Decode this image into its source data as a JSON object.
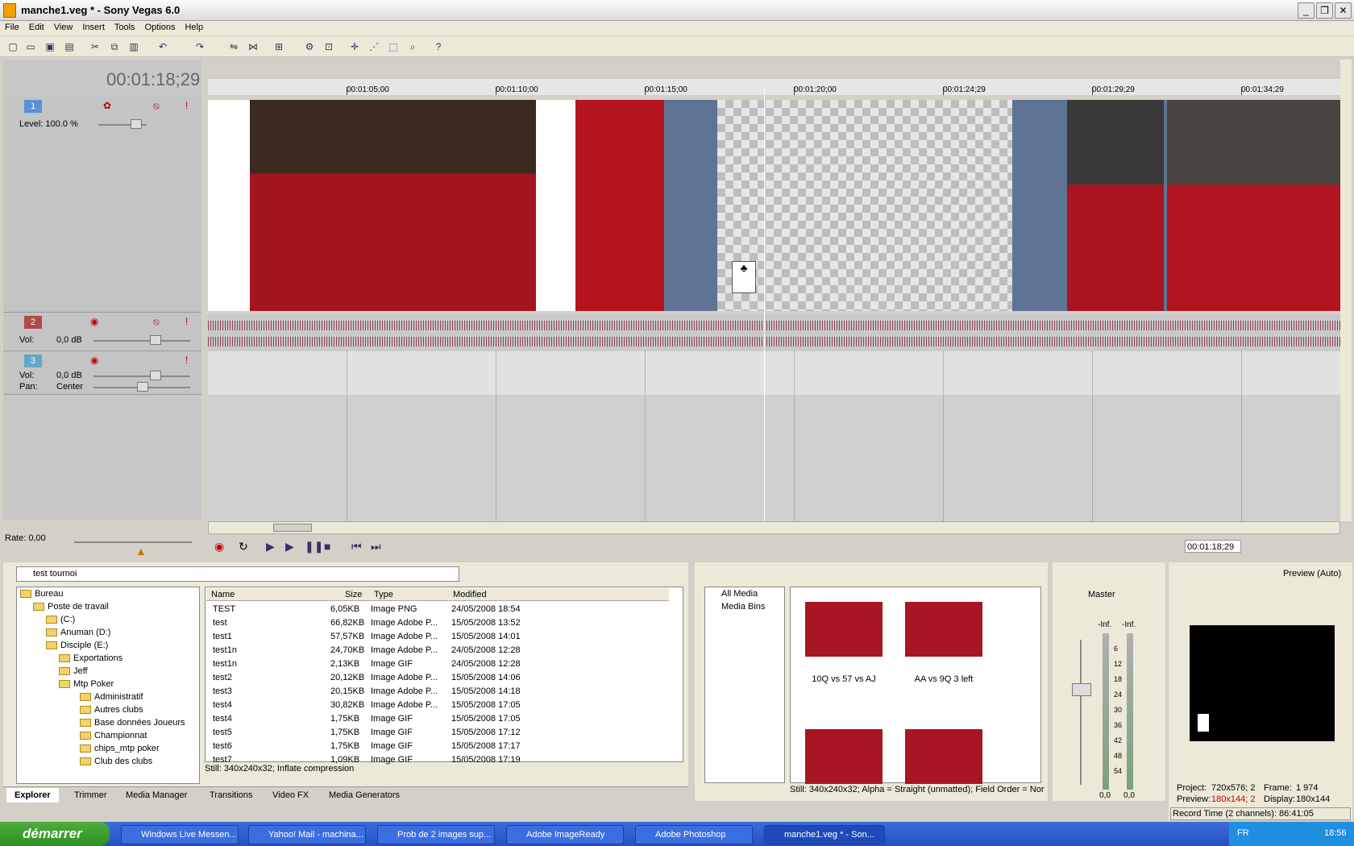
{
  "window": {
    "title": "manche1.veg * - Sony Vegas 6.0"
  },
  "menu": [
    "File",
    "Edit",
    "View",
    "Insert",
    "Tools",
    "Options",
    "Help"
  ],
  "timeline": {
    "timecode": "00:01:18;29",
    "ruler": [
      "00:01:05;00",
      "00:01:10;00",
      "00:01:15;00",
      "00:01:20;00",
      "00:01:24;29",
      "00:01:29;29",
      "00:01:34;29"
    ]
  },
  "tracks": [
    {
      "num": "1",
      "level_label": "Level: 100.0 %",
      "color": "#5b8fd6"
    },
    {
      "num": "2",
      "vol_label": "Vol:",
      "vol_value": "0,0 dB",
      "color": "#b14a4a"
    },
    {
      "num": "3",
      "vol_label": "Vol:",
      "vol_value": "0,0 dB",
      "pan_label": "Pan:",
      "pan_value": "Center",
      "color": "#5fa8c8"
    }
  ],
  "transport": {
    "rate": "Rate: 0,00",
    "position": "00:01:18;29"
  },
  "explorer": {
    "path": "test tournoi",
    "tree": [
      "Bureau",
      "Poste de travail",
      "(C:)",
      "Anuman (D:)",
      "Disciple (E:)",
      "Exportations",
      "Jeff",
      "Mtp Poker",
      "Administratif",
      "Autres clubs",
      "Base données Joueurs",
      "Championnat",
      "chips_mtp poker",
      "Club des clubs"
    ],
    "columns": [
      "Name",
      "Size",
      "Type",
      "Modified"
    ],
    "files": [
      [
        "TEST",
        "6,05KB",
        "Image PNG",
        "24/05/2008 18:54"
      ],
      [
        "test",
        "66,82KB",
        "Image Adobe P...",
        "15/05/2008 13:52"
      ],
      [
        "test1",
        "57,57KB",
        "Image Adobe P...",
        "15/05/2008 14:01"
      ],
      [
        "test1n",
        "24,70KB",
        "Image Adobe P...",
        "24/05/2008 12:28"
      ],
      [
        "test1n",
        "2,13KB",
        "Image GIF",
        "24/05/2008 12:28"
      ],
      [
        "test2",
        "20,12KB",
        "Image Adobe P...",
        "15/05/2008 14:06"
      ],
      [
        "test3",
        "20,15KB",
        "Image Adobe P...",
        "15/05/2008 14:18"
      ],
      [
        "test4",
        "30,82KB",
        "Image Adobe P...",
        "15/05/2008 17:05"
      ],
      [
        "test4",
        "1,75KB",
        "Image GIF",
        "15/05/2008 17:05"
      ],
      [
        "test5",
        "1,75KB",
        "Image GIF",
        "15/05/2008 17:12"
      ],
      [
        "test6",
        "1,75KB",
        "Image GIF",
        "15/05/2008 17:17"
      ],
      [
        "test7",
        "1,09KB",
        "Image GIF",
        "15/05/2008 17:19"
      ]
    ],
    "status": "Still: 340x240x32; Inflate compression"
  },
  "tabs": [
    "Explorer",
    "Trimmer",
    "Media Manager",
    "Transitions",
    "Video FX",
    "Media Generators"
  ],
  "media": {
    "tree": [
      "All Media",
      "Media Bins"
    ],
    "thumbs": [
      "10Q vs 57 vs AJ",
      "AA vs 9Q 3 left",
      "",
      ""
    ],
    "status": "Still: 340x240x32; Alpha = Straight (unmatted); Field Order = Nor"
  },
  "mixer": {
    "label": "Master",
    "inf1": "-Inf.",
    "inf2": "-Inf.",
    "scale": [
      "6",
      "12",
      "18",
      "24",
      "30",
      "36",
      "42",
      "48",
      "54"
    ],
    "val1": "0,0",
    "val2": "0,0"
  },
  "preview": {
    "mode": "Preview (Auto)",
    "project_label": "Project:",
    "project_value": "720x576; 2",
    "frame_label": "Frame:",
    "frame_value": "1 974",
    "preview_label": "Preview:",
    "preview_value": "180x144; 2",
    "display_label": "Display:",
    "display_value": "180x144",
    "record": "Record Time (2 channels): 86:41:05"
  },
  "taskbar": {
    "start": "démarrer",
    "tasks": [
      "Windows Live Messen...",
      "Yahoo! Mail - machina...",
      "Prob de 2 images sup...",
      "Adobe ImageReady",
      "Adobe Photoshop",
      "manche1.veg * - Son..."
    ],
    "lang": "FR",
    "clock": "18:56"
  }
}
